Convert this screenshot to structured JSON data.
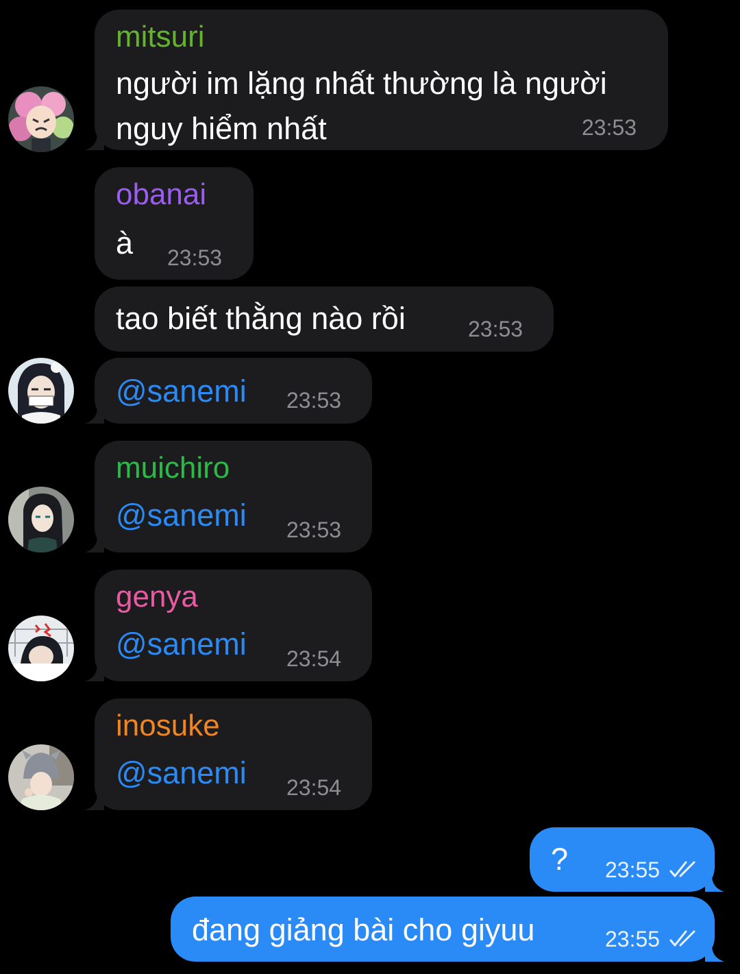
{
  "messages": [
    {
      "sender": "mitsuri",
      "sender_color": "#63b32d",
      "lines": [
        "người im lặng nhất thường là người",
        "nguy hiểm nhất"
      ],
      "time": "23:53"
    },
    {
      "sender": "obanai",
      "sender_color": "#9b5cf0",
      "text": "à",
      "time": "23:53"
    },
    {
      "text": "tao biết thằng nào rồi",
      "time": "23:53"
    },
    {
      "text": "@sanemi",
      "time": "23:53"
    },
    {
      "sender": "muichiro",
      "sender_color": "#2fb84a",
      "text": "@sanemi",
      "time": "23:53"
    },
    {
      "sender": "genya",
      "sender_color": "#e85ba3",
      "text": "@sanemi",
      "time": "23:54"
    },
    {
      "sender": "inosuke",
      "sender_color": "#ef8524",
      "text": "@sanemi",
      "time": "23:54"
    },
    {
      "text": "?",
      "time": "23:55",
      "outgoing": true
    },
    {
      "text": "đang giảng bài cho giyuu",
      "time": "23:55",
      "outgoing": true
    }
  ],
  "colors": {
    "background": "#000000",
    "incoming_bubble": "#1c1c1e",
    "outgoing_bubble": "#2a8af6",
    "mention": "#2a8af6",
    "timestamp": "#8d8d93"
  },
  "icons": {
    "read_receipt": "double-check-icon"
  }
}
